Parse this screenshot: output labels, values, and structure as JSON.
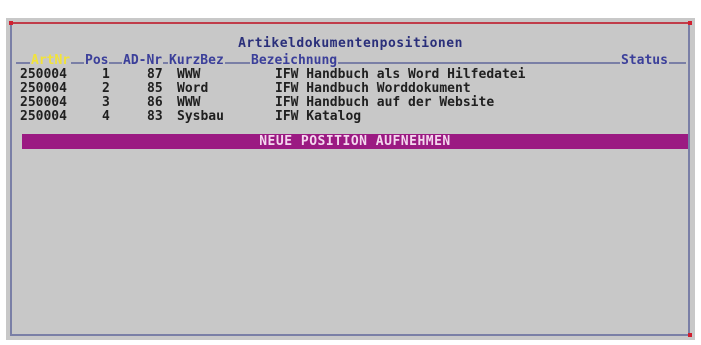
{
  "window": {
    "title": "Artikeldokumentenpositionen"
  },
  "columns": {
    "artnr": "ArtNr",
    "pos": "Pos",
    "ad_nr": "AD-Nr",
    "kurzbez": "KurzBez",
    "bezeichnung": "Bezeichnung",
    "status": "Status"
  },
  "rows": [
    {
      "artnr": "250004",
      "pos": "1",
      "ad_nr": "87",
      "kurzbez": "WWW",
      "bezeichnung": "IFW Handbuch als Word Hilfedatei"
    },
    {
      "artnr": "250004",
      "pos": "2",
      "ad_nr": "85",
      "kurzbez": "Word",
      "bezeichnung": "IFW Handbuch Worddokument"
    },
    {
      "artnr": "250004",
      "pos": "3",
      "ad_nr": "86",
      "kurzbez": "WWW",
      "bezeichnung": "IFW Handbuch auf der Website"
    },
    {
      "artnr": "250004",
      "pos": "4",
      "ad_nr": "83",
      "kurzbez": "Sysbau",
      "bezeichnung": "IFW Katalog"
    }
  ],
  "new_position_label": "NEUE POSITION AUFNEHMEN",
  "colors": {
    "background": "#c8c8c8",
    "frame": "#7a7fa6",
    "header_text": "#3b3f9a",
    "header_highlight": "#f2e33a",
    "selection_bar": "#9b1a82",
    "corner_marker": "#d02030"
  }
}
